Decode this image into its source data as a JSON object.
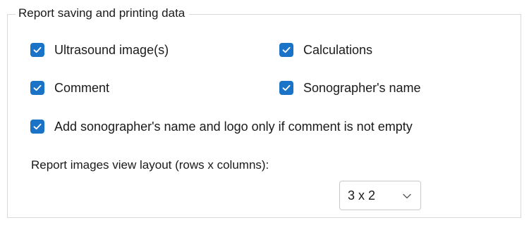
{
  "groupbox": {
    "title": "Report saving and printing data"
  },
  "checkboxes": [
    {
      "label": "Ultrasound image(s)",
      "checked": true
    },
    {
      "label": "Calculations",
      "checked": true
    },
    {
      "label": "Comment",
      "checked": true
    },
    {
      "label": "Sonographer's name",
      "checked": true
    },
    {
      "label": "Add sonographer's name and logo only if comment is not empty",
      "checked": true
    }
  ],
  "layout": {
    "label": "Report images view layout (rows x columns):",
    "selected": "3 x 2",
    "arrow_icon": "chevron-down-icon"
  },
  "colors": {
    "checkbox_fill": "#1a73c7",
    "border": "#d9d9d9"
  }
}
